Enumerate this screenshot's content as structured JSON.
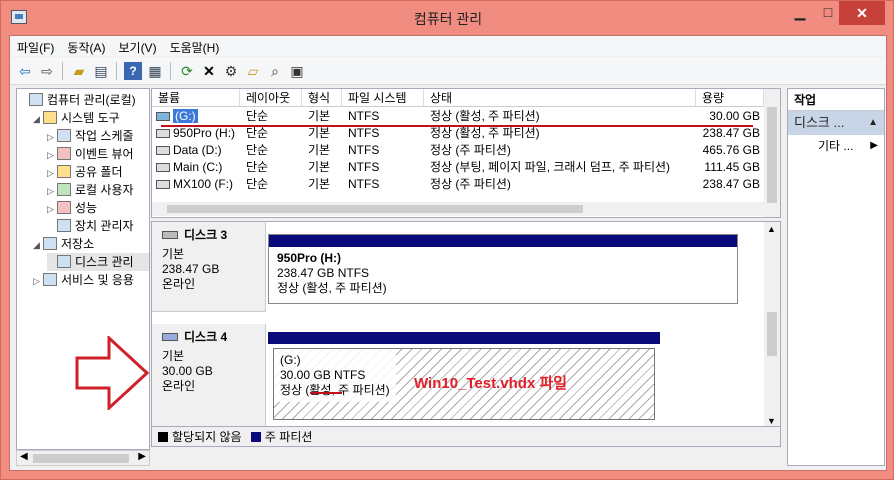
{
  "window": {
    "title": "컴퓨터 관리",
    "min_glyph": "▁",
    "max_glyph": "□",
    "close_glyph": "✕"
  },
  "menu": [
    "파일(F)",
    "동작(A)",
    "보기(V)",
    "도움말(H)"
  ],
  "toolbar_icons": [
    "back-icon",
    "forward-icon",
    "up-folder-icon",
    "show-tree-icon",
    "help-icon",
    "properties-icon",
    "refresh-icon",
    "delete-icon",
    "settings-icon",
    "open-folder-icon",
    "search-icon",
    "export-icon"
  ],
  "tree": [
    {
      "label": "컴퓨터 관리(로컬)",
      "level": 0,
      "exp": ""
    },
    {
      "label": "시스템 도구",
      "level": 1,
      "exp": "◢"
    },
    {
      "label": "작업 스케줄",
      "level": 2,
      "exp": "▷"
    },
    {
      "label": "이벤트 뷰어",
      "level": 2,
      "exp": "▷"
    },
    {
      "label": "공유 폴더",
      "level": 2,
      "exp": "▷"
    },
    {
      "label": "로컬 사용자",
      "level": 2,
      "exp": "▷"
    },
    {
      "label": "성능",
      "level": 2,
      "exp": "▷"
    },
    {
      "label": "장치 관리자",
      "level": 2,
      "exp": ""
    },
    {
      "label": "저장소",
      "level": 1,
      "exp": "◢"
    },
    {
      "label": "디스크 관리",
      "level": 2,
      "exp": ""
    },
    {
      "label": "서비스 및 응용",
      "level": 1,
      "exp": "▷"
    }
  ],
  "volume_columns": [
    "볼륨",
    "레이아웃",
    "형식",
    "파일 시스템",
    "상태",
    "용량"
  ],
  "volumes": [
    {
      "name": "(G:)",
      "layout": "단순",
      "type": "기본",
      "fs": "NTFS",
      "status": "정상 (활성, 주 파티션)",
      "size": "30.00 GB"
    },
    {
      "name": "950Pro (H:)",
      "layout": "단순",
      "type": "기본",
      "fs": "NTFS",
      "status": "정상 (활성, 주 파티션)",
      "size": "238.47 GB"
    },
    {
      "name": "Data (D:)",
      "layout": "단순",
      "type": "기본",
      "fs": "NTFS",
      "status": "정상 (주 파티션)",
      "size": "465.76 GB"
    },
    {
      "name": "Main (C:)",
      "layout": "단순",
      "type": "기본",
      "fs": "NTFS",
      "status": "정상 (부팅, 페이지 파일, 크래시 덤프, 주 파티션)",
      "size": "111.45 GB"
    },
    {
      "name": "MX100 (F:)",
      "layout": "단순",
      "type": "기본",
      "fs": "NTFS",
      "status": "정상 (주 파티션)",
      "size": "238.47 GB"
    }
  ],
  "disks": [
    {
      "name": "디스크 3",
      "type": "기본",
      "size": "238.47 GB",
      "state": "온라인",
      "partition": {
        "label": "950Pro  (H:)",
        "detail": "238.47 GB NTFS",
        "status": "정상 (활성, 주 파티션)"
      }
    },
    {
      "name": "디스크 4",
      "type": "기본",
      "size": "30.00 GB",
      "state": "온라인",
      "partition": {
        "label": "(G:)",
        "detail": "30.00 GB NTFS",
        "status": "정상 (활성, 주 파티션)"
      }
    }
  ],
  "annotation": "Win10_Test.vhdx 파일",
  "legend": {
    "unallocated": "할당되지 않음",
    "primary": "주 파티션",
    "unallocated_color": "#000000",
    "primary_color": "#0a0a7a"
  },
  "actions": {
    "header": "작업",
    "section": "디스크 ...",
    "more": "기타 ..."
  }
}
